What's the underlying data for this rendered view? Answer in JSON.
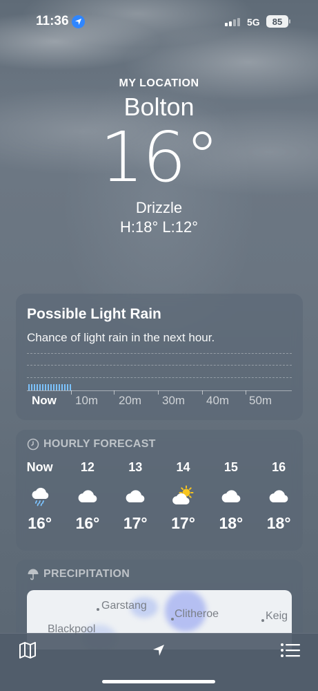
{
  "status_bar": {
    "time": "11:36",
    "network": "5G",
    "battery": "85"
  },
  "header": {
    "location_label": "MY LOCATION",
    "city": "Bolton",
    "temperature": "16°",
    "condition": "Drizzle",
    "high_low": "H:18°  L:12°"
  },
  "rain_card": {
    "title": "Possible Light Rain",
    "subtitle": "Chance of light rain in the next hour.",
    "axis_labels": [
      "Now",
      "10m",
      "20m",
      "30m",
      "40m",
      "50m"
    ],
    "bar_color": "#7cc3ff"
  },
  "hourly": {
    "header": "HOURLY FORECAST",
    "items": [
      {
        "label": "Now",
        "icon": "cloud-drizzle-icon",
        "temp": "16°"
      },
      {
        "label": "12",
        "icon": "cloud-icon",
        "temp": "16°"
      },
      {
        "label": "13",
        "icon": "cloud-icon",
        "temp": "17°"
      },
      {
        "label": "14",
        "icon": "partly-sunny-icon",
        "temp": "17°"
      },
      {
        "label": "15",
        "icon": "cloud-icon",
        "temp": "18°"
      },
      {
        "label": "16",
        "icon": "cloud-icon",
        "temp": "18°"
      }
    ]
  },
  "precipitation": {
    "header": "PRECIPITATION",
    "places": [
      "Garstang",
      "Clitheroe",
      "Keig",
      "Blackpool"
    ]
  },
  "toolbar": {
    "map_icon": "map-icon",
    "location_icon": "location-arrow-icon",
    "list_icon": "list-icon"
  }
}
